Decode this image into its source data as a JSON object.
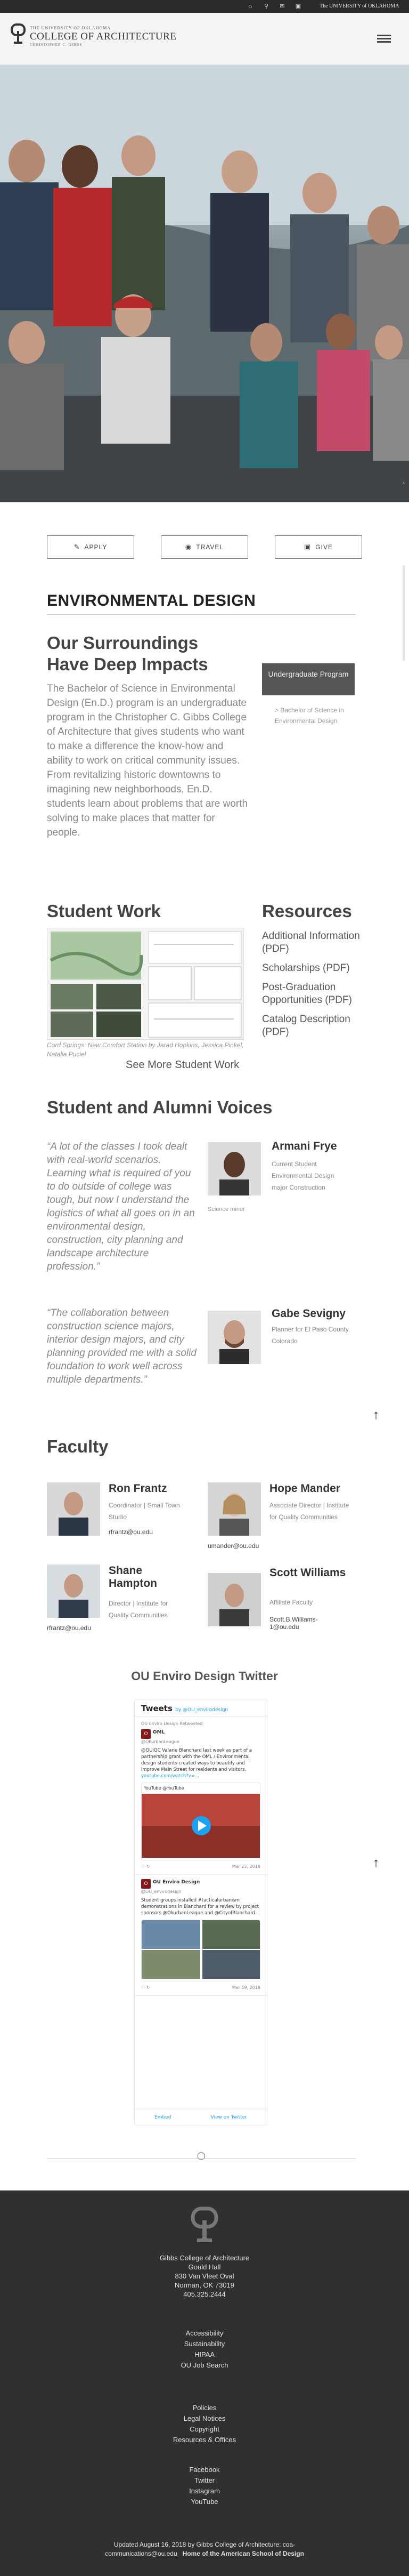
{
  "topbar": {
    "icons": [
      "home-icon",
      "search-icon",
      "mail-icon",
      "monitor-icon"
    ],
    "link": "The UNIVERSITY of OKLAHOMA"
  },
  "header": {
    "small_line": "THE UNIVERSITY OF OKLAHOMA",
    "logo_title": "COLLEGE OF ARCHITECTURE",
    "sub_line": "CHRISTOPHER C. GIBBS"
  },
  "ctas": [
    {
      "label": "APPLY",
      "icon": "edit-icon"
    },
    {
      "label": "TRAVEL",
      "icon": "globe-icon"
    },
    {
      "label": "GIVE",
      "icon": "gift-icon"
    }
  ],
  "main": {
    "title": "ENVIRONMENTAL DESIGN",
    "impact_heading": "Our Surroundings Have Deep Impacts",
    "impact_body": "The Bachelor of Science in Environmental Design (En.D.) program is an undergraduate program in the Christopher C. Gibbs College of Architecture that gives students who want to make a difference the know-how and ability to work on critical community issues. From revitalizing historic downtowns to imagining new neighborhoods, En.D. students learn about problems that are worth solving to make places that matter for people.",
    "ug_button": "Undergraduate Program",
    "ug_link": "> Bachelor of Science in Environmental Design"
  },
  "student_work": {
    "heading": "Student Work",
    "caption": "Cord Springs: New Comfort Station by Jarad Hopkins, Jessica Pinkel, Natalia Puciel",
    "more": "See More Student Work"
  },
  "resources": {
    "heading": "Resources",
    "items": [
      "Additional Information (PDF)",
      "Scholarships (PDF)",
      "Post-Graduation Opportunities (PDF)",
      "Catalog Description (PDF)"
    ]
  },
  "voices": {
    "heading": "Student and Alumni Voices",
    "items": [
      {
        "quote": "“A lot of the classes I took dealt with real-world scenarios. Learning what is required of you to do outside of college was tough, but now I understand the logistics of what all goes on in an environmental design, construction, city planning and landscape architecture profession.”",
        "name": "Armani Frye",
        "role": "Current Student Environmental Design major Construction",
        "caption": "Science minor"
      },
      {
        "quote": "“The collaboration between construction science majors, interior design majors, and city planning provided me with a solid foundation to work well across multiple departments.”",
        "name": "Gabe Sevigny",
        "role": "Planner for El Paso County, Colorado"
      }
    ]
  },
  "faculty": {
    "heading": "Faculty",
    "people": [
      {
        "name": "Ron Frantz",
        "role": "Coordinator | Small Town Studio",
        "email": "rfrantz@ou.edu"
      },
      {
        "name": "Hope Mander",
        "role": "Associate Director | Institute for Quality Communities",
        "email": "umander@ou.edu"
      },
      {
        "name": "Shane Hampton",
        "role": "Director | Institute for Quality Communities",
        "email": "rfrantz@ou.edu"
      },
      {
        "name": "Scott Williams",
        "role": "Affiliate Faculty",
        "email": "Scott.B.Williams-1@ou.edu"
      }
    ]
  },
  "twitter": {
    "heading": "OU Enviro Design Twitter",
    "widget_title": "Tweets",
    "widget_by": "by @OU_envirodesign",
    "tweet1": {
      "retweet": "OU Enviro Design Retweeted",
      "author": "OML",
      "handle": "@OKurbanLeague",
      "text": "@OUIQC Valarie Blanchard last week as part of a partnership grant with the OML / Environmental design students created ways to beautify and improve Main Street for residents and visitors.",
      "link": "youtube.com/watch?v=...",
      "card_source": "YouTube @YouTube",
      "date": "Mar 22, 2018"
    },
    "tweet2": {
      "author": "OU Enviro Design",
      "handle": "@OU_envirodesign",
      "text": "Student groups installed #tacticalurbanism demonstrations in Blanchard for a review by project sponsors @OkurbanLeague and @CityofBlanchard.",
      "date": "Mar 19, 2018"
    },
    "embed": "Embed",
    "view": "View on Twitter"
  },
  "footer": {
    "address": [
      "Gibbs College of Architecture",
      "Gould Hall",
      "830 Van Vleet Oval",
      "Norman, OK 73019",
      "405.325.2444"
    ],
    "links1": [
      "Accessibility",
      "Sustainability",
      "HIPAA",
      "OU Job Search"
    ],
    "links2": [
      "Policies",
      "Legal Notices",
      "Copyright",
      "Resources & Offices"
    ],
    "social": [
      "Facebook",
      "Twitter",
      "Instagram",
      "YouTube"
    ],
    "updated_line1": "Updated August 16, 2018 by Gibbs College of Architecture: coa-",
    "updated_line2a": "communications@ou.edu",
    "updated_line2b": "Home of the American School of Design"
  },
  "colors": {
    "topbar": "#2a2a2a",
    "footer": "#303030",
    "ou_crimson": "#841617",
    "twitter_blue": "#1da1f2"
  }
}
